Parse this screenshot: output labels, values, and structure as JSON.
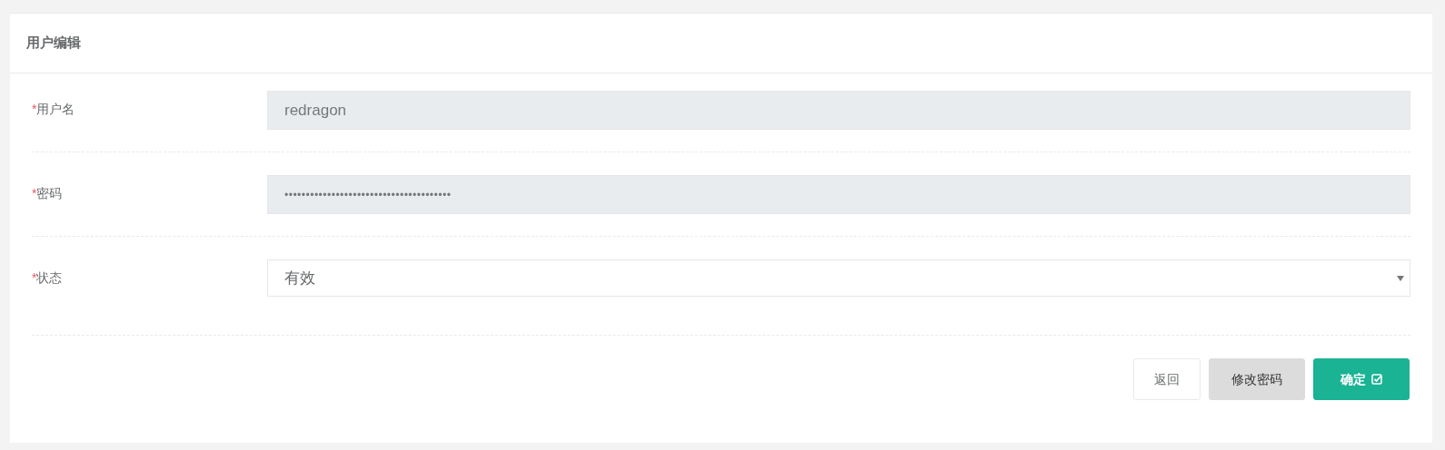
{
  "panel": {
    "title": "用户编辑"
  },
  "fields": [
    {
      "kind": "text",
      "label": "用户名",
      "required_mark": "*",
      "disabled": true,
      "value": "redragon"
    },
    {
      "kind": "password",
      "label": "密码",
      "required_mark": "*",
      "disabled": true,
      "value": "•••••••••••••••••••••••••••••••••••••••"
    },
    {
      "kind": "select",
      "label": "状态",
      "required_mark": "*",
      "disabled": false,
      "value": "有效"
    }
  ],
  "buttons": [
    {
      "kind": "default",
      "label": "返回"
    },
    {
      "kind": "secondary",
      "label": "修改密码"
    },
    {
      "kind": "primary",
      "label": "确定"
    }
  ]
}
